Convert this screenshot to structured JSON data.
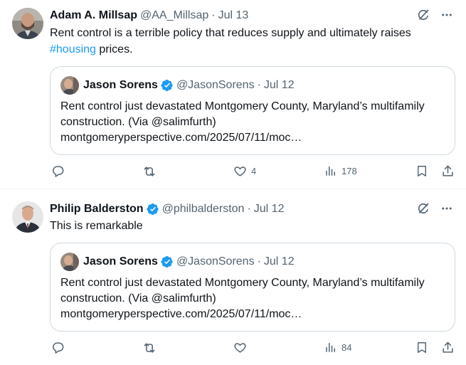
{
  "tweets": [
    {
      "author_name": "Adam A. Millsap",
      "author_handle": "@AA_Millsap",
      "separator": "·",
      "date": "Jul 13",
      "text_before": "Rent control is a terrible policy that reduces supply and ultimately raises ",
      "hashtag": "#housing",
      "text_after": " prices.",
      "quote": {
        "author_name": "Jason Sorens",
        "author_handle": "@JasonSorens",
        "separator": "·",
        "date": "Jul 12",
        "text": "Rent control just devastated Montgomery County, Maryland’s multifamily construction. (Via @salimfurth) montgomeryperspective.com/2025/07/11/moc…"
      },
      "stats": {
        "replies": "",
        "retweets": "",
        "likes": "4",
        "views": "178"
      }
    },
    {
      "author_name": "Philip Balderston",
      "author_handle": "@philbalderston",
      "separator": "·",
      "date": "Jul 12",
      "text": "This is remarkable",
      "quote": {
        "author_name": "Jason Sorens",
        "author_handle": "@JasonSorens",
        "separator": "·",
        "date": "Jul 12",
        "text": "Rent control just devastated Montgomery County, Maryland’s multifamily construction. (Via @salimfurth) montgomeryperspective.com/2025/07/11/moc…"
      },
      "stats": {
        "replies": "",
        "retweets": "",
        "likes": "",
        "views": "84"
      }
    }
  ],
  "colors": {
    "text": "#0f1419",
    "secondary": "#536471",
    "link": "#1d9bf0",
    "verified": "#1d9bf0",
    "border": "#cfd9de"
  },
  "icons": [
    "grok-icon",
    "more-icon",
    "verified-icon",
    "reply-icon",
    "retweet-icon",
    "like-icon",
    "views-icon",
    "bookmark-icon",
    "share-icon"
  ]
}
